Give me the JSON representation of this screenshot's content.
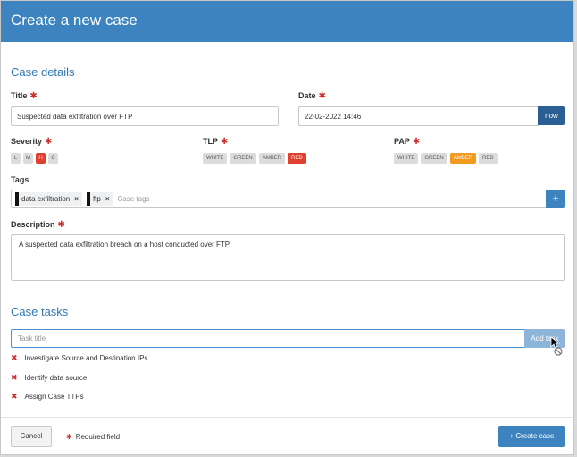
{
  "dialog": {
    "title": "Create a new case"
  },
  "case_details": {
    "heading": "Case details",
    "title_label": "Title",
    "title_value": "Suspected data exfiltration over FTP",
    "date_label": "Date",
    "date_value": "22-02-2022 14:46",
    "now_label": "now",
    "severity_label": "Severity",
    "severity_options": [
      "L",
      "M",
      "H",
      "C"
    ],
    "severity_selected": "H",
    "tlp_label": "TLP",
    "tlp_options": [
      "WHITE",
      "GREEN",
      "AMBER",
      "RED"
    ],
    "tlp_selected": "RED",
    "pap_label": "PAP",
    "pap_options": [
      "WHITE",
      "GREEN",
      "AMBER",
      "RED"
    ],
    "pap_selected": "AMBER",
    "tags_label": "Tags",
    "tags": [
      "data exfiltration",
      "ftp"
    ],
    "tags_placeholder": "Case tags",
    "add_tag_label": "+",
    "description_label": "Description",
    "description_value": "A suspected data exfiltration breach on a host conducted over FTP."
  },
  "case_tasks": {
    "heading": "Case tasks",
    "task_placeholder": "Task title",
    "add_task_label": "Add task",
    "tasks": [
      "Investigate Source and Destination IPs",
      "Identify data source",
      "Assign Case TTPs"
    ]
  },
  "footer": {
    "cancel_label": "Cancel",
    "required_note": "Required field",
    "create_label": "Create case"
  },
  "colors": {
    "header": "#3c83bf",
    "required": "#c9302c",
    "red_selected": "#e0402e",
    "amber_selected": "#f19a21",
    "now_button": "#2b5f94"
  },
  "icons": {
    "required": "asterisk-icon",
    "remove_task": "close-icon",
    "remove_tag": "close-icon",
    "add": "plus-icon",
    "cursor": "not-allowed-cursor-icon"
  }
}
